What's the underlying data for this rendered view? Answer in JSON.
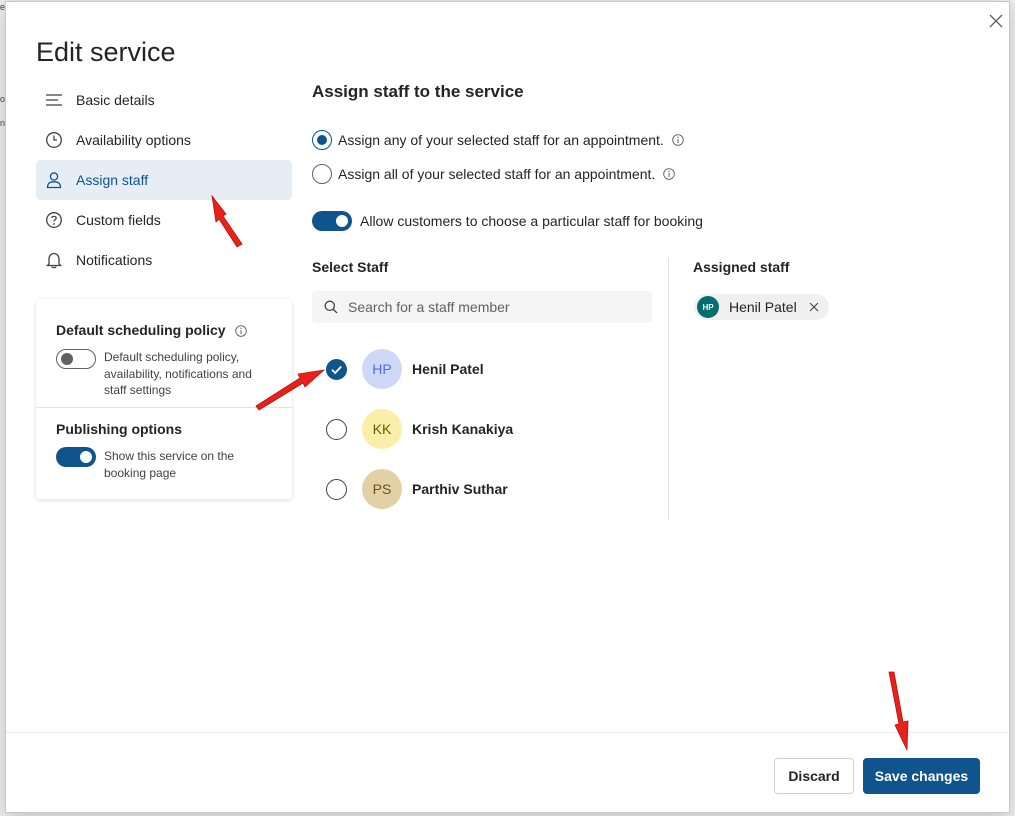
{
  "background": {
    "fragments": [
      "e",
      "o",
      "n"
    ]
  },
  "dialog": {
    "title": "Edit service"
  },
  "nav": {
    "items": [
      {
        "label": "Basic details",
        "icon": "lines-icon",
        "active": false
      },
      {
        "label": "Availability options",
        "icon": "clock-icon",
        "active": false
      },
      {
        "label": "Assign staff",
        "icon": "person-icon",
        "active": true
      },
      {
        "label": "Custom fields",
        "icon": "question-circle-icon",
        "active": false
      },
      {
        "label": "Notifications",
        "icon": "bell-icon",
        "active": false
      }
    ]
  },
  "policy_card": {
    "default_heading": "Default scheduling policy",
    "default_desc": "Default scheduling policy, availability, notifications and staff settings",
    "default_toggle_on": false,
    "publishing_heading": "Publishing options",
    "publishing_desc": "Show this service on the booking page",
    "publishing_toggle_on": true
  },
  "main": {
    "section_title": "Assign staff to the service",
    "radio_options": [
      {
        "label": "Assign any of your selected staff for an appointment.",
        "checked": true
      },
      {
        "label": "Assign all of your selected staff for an appointment.",
        "checked": false
      }
    ],
    "allow_toggle_label": "Allow customers to choose a particular staff for booking",
    "allow_toggle_on": true,
    "select_staff_heading": "Select Staff",
    "search_placeholder": "Search for a staff member",
    "staff": [
      {
        "initials": "HP",
        "name": "Henil Patel",
        "checked": true,
        "avatar_bg": "#cfd8f7",
        "avatar_fg": "#4f6bed"
      },
      {
        "initials": "KK",
        "name": "Krish Kanakiya",
        "checked": false,
        "avatar_bg": "#fbeea8",
        "avatar_fg": "#6b5a00"
      },
      {
        "initials": "PS",
        "name": "Parthiv Suthar",
        "checked": false,
        "avatar_bg": "#e3d1a6",
        "avatar_fg": "#6b4e16"
      }
    ],
    "assigned_heading": "Assigned staff",
    "assigned": [
      {
        "initials": "HP",
        "name": "Henil Patel"
      }
    ]
  },
  "footer": {
    "discard_label": "Discard",
    "save_label": "Save changes"
  },
  "colors": {
    "accent": "#0f548c",
    "active_nav_bg": "#e6edf5",
    "annotation_red": "#e8221b"
  }
}
